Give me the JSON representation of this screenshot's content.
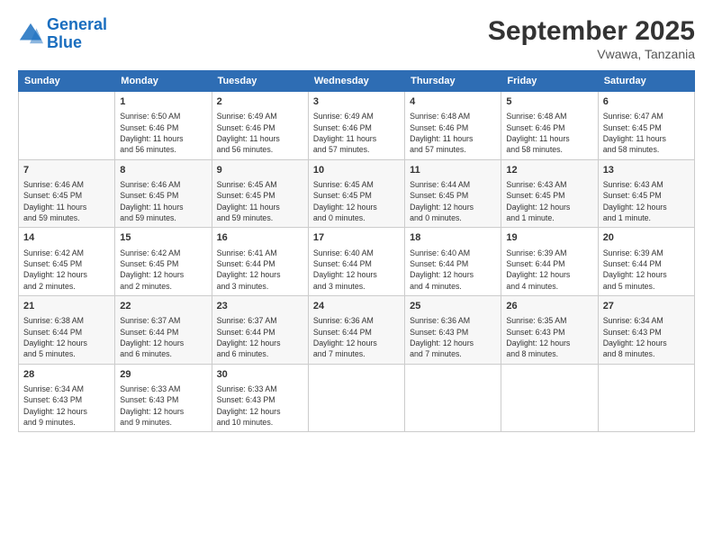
{
  "header": {
    "logo_line1": "General",
    "logo_line2": "Blue",
    "month": "September 2025",
    "location": "Vwawa, Tanzania"
  },
  "days_of_week": [
    "Sunday",
    "Monday",
    "Tuesday",
    "Wednesday",
    "Thursday",
    "Friday",
    "Saturday"
  ],
  "weeks": [
    [
      {
        "day": "",
        "info": ""
      },
      {
        "day": "1",
        "info": "Sunrise: 6:50 AM\nSunset: 6:46 PM\nDaylight: 11 hours\nand 56 minutes."
      },
      {
        "day": "2",
        "info": "Sunrise: 6:49 AM\nSunset: 6:46 PM\nDaylight: 11 hours\nand 56 minutes."
      },
      {
        "day": "3",
        "info": "Sunrise: 6:49 AM\nSunset: 6:46 PM\nDaylight: 11 hours\nand 57 minutes."
      },
      {
        "day": "4",
        "info": "Sunrise: 6:48 AM\nSunset: 6:46 PM\nDaylight: 11 hours\nand 57 minutes."
      },
      {
        "day": "5",
        "info": "Sunrise: 6:48 AM\nSunset: 6:46 PM\nDaylight: 11 hours\nand 58 minutes."
      },
      {
        "day": "6",
        "info": "Sunrise: 6:47 AM\nSunset: 6:45 PM\nDaylight: 11 hours\nand 58 minutes."
      }
    ],
    [
      {
        "day": "7",
        "info": "Sunrise: 6:46 AM\nSunset: 6:45 PM\nDaylight: 11 hours\nand 59 minutes."
      },
      {
        "day": "8",
        "info": "Sunrise: 6:46 AM\nSunset: 6:45 PM\nDaylight: 11 hours\nand 59 minutes."
      },
      {
        "day": "9",
        "info": "Sunrise: 6:45 AM\nSunset: 6:45 PM\nDaylight: 11 hours\nand 59 minutes."
      },
      {
        "day": "10",
        "info": "Sunrise: 6:45 AM\nSunset: 6:45 PM\nDaylight: 12 hours\nand 0 minutes."
      },
      {
        "day": "11",
        "info": "Sunrise: 6:44 AM\nSunset: 6:45 PM\nDaylight: 12 hours\nand 0 minutes."
      },
      {
        "day": "12",
        "info": "Sunrise: 6:43 AM\nSunset: 6:45 PM\nDaylight: 12 hours\nand 1 minute."
      },
      {
        "day": "13",
        "info": "Sunrise: 6:43 AM\nSunset: 6:45 PM\nDaylight: 12 hours\nand 1 minute."
      }
    ],
    [
      {
        "day": "14",
        "info": "Sunrise: 6:42 AM\nSunset: 6:45 PM\nDaylight: 12 hours\nand 2 minutes."
      },
      {
        "day": "15",
        "info": "Sunrise: 6:42 AM\nSunset: 6:45 PM\nDaylight: 12 hours\nand 2 minutes."
      },
      {
        "day": "16",
        "info": "Sunrise: 6:41 AM\nSunset: 6:44 PM\nDaylight: 12 hours\nand 3 minutes."
      },
      {
        "day": "17",
        "info": "Sunrise: 6:40 AM\nSunset: 6:44 PM\nDaylight: 12 hours\nand 3 minutes."
      },
      {
        "day": "18",
        "info": "Sunrise: 6:40 AM\nSunset: 6:44 PM\nDaylight: 12 hours\nand 4 minutes."
      },
      {
        "day": "19",
        "info": "Sunrise: 6:39 AM\nSunset: 6:44 PM\nDaylight: 12 hours\nand 4 minutes."
      },
      {
        "day": "20",
        "info": "Sunrise: 6:39 AM\nSunset: 6:44 PM\nDaylight: 12 hours\nand 5 minutes."
      }
    ],
    [
      {
        "day": "21",
        "info": "Sunrise: 6:38 AM\nSunset: 6:44 PM\nDaylight: 12 hours\nand 5 minutes."
      },
      {
        "day": "22",
        "info": "Sunrise: 6:37 AM\nSunset: 6:44 PM\nDaylight: 12 hours\nand 6 minutes."
      },
      {
        "day": "23",
        "info": "Sunrise: 6:37 AM\nSunset: 6:44 PM\nDaylight: 12 hours\nand 6 minutes."
      },
      {
        "day": "24",
        "info": "Sunrise: 6:36 AM\nSunset: 6:44 PM\nDaylight: 12 hours\nand 7 minutes."
      },
      {
        "day": "25",
        "info": "Sunrise: 6:36 AM\nSunset: 6:43 PM\nDaylight: 12 hours\nand 7 minutes."
      },
      {
        "day": "26",
        "info": "Sunrise: 6:35 AM\nSunset: 6:43 PM\nDaylight: 12 hours\nand 8 minutes."
      },
      {
        "day": "27",
        "info": "Sunrise: 6:34 AM\nSunset: 6:43 PM\nDaylight: 12 hours\nand 8 minutes."
      }
    ],
    [
      {
        "day": "28",
        "info": "Sunrise: 6:34 AM\nSunset: 6:43 PM\nDaylight: 12 hours\nand 9 minutes."
      },
      {
        "day": "29",
        "info": "Sunrise: 6:33 AM\nSunset: 6:43 PM\nDaylight: 12 hours\nand 9 minutes."
      },
      {
        "day": "30",
        "info": "Sunrise: 6:33 AM\nSunset: 6:43 PM\nDaylight: 12 hours\nand 10 minutes."
      },
      {
        "day": "",
        "info": ""
      },
      {
        "day": "",
        "info": ""
      },
      {
        "day": "",
        "info": ""
      },
      {
        "day": "",
        "info": ""
      }
    ]
  ]
}
